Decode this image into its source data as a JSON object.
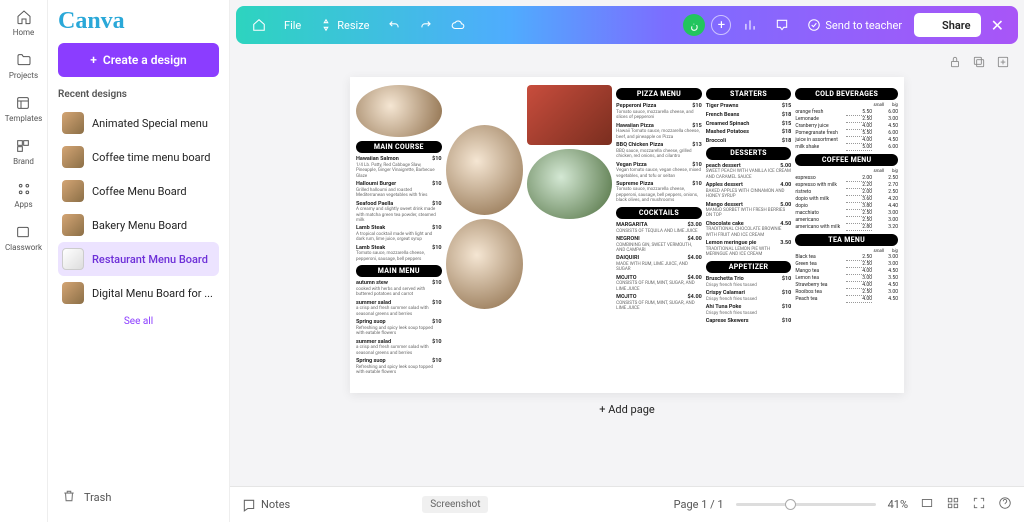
{
  "rail": {
    "items": [
      {
        "label": "Home"
      },
      {
        "label": "Projects"
      },
      {
        "label": "Templates"
      },
      {
        "label": "Brand"
      },
      {
        "label": "Apps"
      },
      {
        "label": "Classwork"
      }
    ]
  },
  "sidebar": {
    "logo": "Canva",
    "create_label": "Create a design",
    "recent_title": "Recent designs",
    "recent": [
      {
        "label": "Animated Special menu"
      },
      {
        "label": "Coffee time menu board"
      },
      {
        "label": "Coffee Menu Board"
      },
      {
        "label": "Bakery Menu Board"
      },
      {
        "label": "Restaurant Menu Board",
        "active": true
      },
      {
        "label": "Digital Menu Board for ..."
      }
    ],
    "see_all": "See all",
    "trash": "Trash"
  },
  "topbar": {
    "file": "File",
    "resize": "Resize",
    "avatar_initial": "ن",
    "send": "Send to teacher",
    "share": "Share"
  },
  "bottombar": {
    "notes": "Notes",
    "screenshot": "Screenshot",
    "page": "Page 1 / 1",
    "zoom": "41%"
  },
  "add_page": "+ Add page",
  "menu": {
    "col1": {
      "head1": "MAIN COURSE",
      "items1": [
        {
          "n": "Hawaiian Salmon",
          "p": "$10",
          "d": "1/4 Lb. Patty, Red Cabbage Slaw, Pineapple, Ginger Vinaigrette, Barbecue Glaze"
        },
        {
          "n": "Halloumi Burger",
          "p": "$10",
          "d": "Grilled halloumi and roasted Mediterranean vegetables with fries"
        },
        {
          "n": "Seafood Paella",
          "p": "$10",
          "d": "A creamy and slightly sweet drink made with matcha green tea powder, steamed milk"
        },
        {
          "n": "Lamb Steak",
          "p": "$10",
          "d": "A tropical cocktail made with light and dark rum, lime juice, orgeat syrup"
        },
        {
          "n": "Lamb Steak",
          "p": "$10",
          "d": "Tomato sauce, mozzarella cheese, pepperoni, sausage, bell peppers"
        }
      ],
      "head2": "MAIN MENU",
      "items2": [
        {
          "n": "autumn stew",
          "p": "$10",
          "d": "cooked with herbs and served with buttered potatoes and carrot"
        },
        {
          "n": "summer salad",
          "p": "$10",
          "d": "a crisp and fresh summer salad with seasonal greens and berries"
        },
        {
          "n": "Spring suop",
          "p": "$10",
          "d": "Refreshing and spicy leek soup topped with eatable flowers"
        },
        {
          "n": "summer salad",
          "p": "$10",
          "d": "a crisp and fresh summer salad with seasonal greens and berries"
        },
        {
          "n": "Spring suop",
          "p": "$10",
          "d": "Refreshing and spicy leek soup topped with eatable flowers"
        }
      ]
    },
    "col2": {
      "head1": "PIZZA MENU",
      "items1": [
        {
          "n": "Pepperoni Pizza",
          "p": "$10",
          "d": "Tomato sauce, mozzarella cheese, and slices of pepperoni"
        },
        {
          "n": "Hawaiian Pizza",
          "p": "$15",
          "d": "Hawaii Tomato sauce, mozzarella cheese, beef, and pineapple on Pizza"
        },
        {
          "n": "BBQ Chicken Pizza",
          "p": "$13",
          "d": "BBQ sauce, mozzarella cheese, grilled chicken, red onions, and cilantro"
        },
        {
          "n": "Vegan Pizza",
          "p": "$10",
          "d": "Vegan tomato sauce, vegan cheese, mixed vegetables, and tofu or seitan"
        },
        {
          "n": "Supreme Pizza",
          "p": "$10",
          "d": "Tomato sauce, mozzarella cheese, pepperoni, sausage, bell peppers, onions, black olives, and mushrooms"
        }
      ],
      "head2": "COCKTAILS",
      "items2": [
        {
          "n": "MARGARITA",
          "p": "$3.00",
          "d": "CONSISTS OF TEQUILA AND LIME JUICE"
        },
        {
          "n": "NEGRONI",
          "p": "$4.00",
          "d": "COMBINING GIN, SWEET VERMOUTH, AND CAMPARI"
        },
        {
          "n": "DAIQUIRI",
          "p": "$4.00",
          "d": "MADE WITH RUM, LIME JUICE, AND SUGAR"
        },
        {
          "n": "MOJITO",
          "p": "$4.00",
          "d": "CONSISTS OF RUM, MINT, SUGAR, AND LIME JUICE"
        },
        {
          "n": "MOJITO",
          "p": "$4.00",
          "d": "CONSISTS OF RUM, MINT, SUGAR, AND LIME JUICE"
        }
      ]
    },
    "col3": {
      "head1": "STARTERS",
      "items1": [
        {
          "n": "Tiger Prawns",
          "p": "$15"
        },
        {
          "n": "French Beans",
          "p": "$18"
        },
        {
          "n": "Creamed Spinach",
          "p": "$15"
        },
        {
          "n": "Mashed Potatoes",
          "p": "$18"
        },
        {
          "n": "Broccoli",
          "p": "$18"
        }
      ],
      "head2": "DESSERTS",
      "items2": [
        {
          "n": "peach dessert",
          "p": "5.00",
          "d": "SWEET PEACH WITH VANILLA ICE CREAM AND CARAMEL SAUCE"
        },
        {
          "n": "Apples dessert",
          "p": "4.00",
          "d": "BAKED APPLES WITH CINNAMON AND HONEY SYRUP"
        },
        {
          "n": "Mango dessert",
          "p": "5.00",
          "d": "MANGO SORBET WITH FRESH BERRIES ON TOP"
        },
        {
          "n": "Chocolate cake",
          "p": "4.50",
          "d": "TRADITIONAL CHOCOLATE BROWNIE WITH FRUIT AND ICE CREAM"
        },
        {
          "n": "Lemon meringue pie",
          "p": "3.50",
          "d": "TRADITIONAL LEMON PIE WITH MERINGUE AND ICE CREAM"
        }
      ],
      "head3": "APPETIZER",
      "items3": [
        {
          "n": "Bruschetta Trio",
          "p": "$10",
          "d": "Crispy french fries tossed"
        },
        {
          "n": "Crispy Calamari",
          "p": "$10",
          "d": "Crispy french fries tossed"
        },
        {
          "n": "Ahi Tuna Poke",
          "p": "$10",
          "d": "Crispy french fries tossed"
        },
        {
          "n": "Caprese Skewers",
          "p": "$10"
        }
      ]
    },
    "col4": {
      "head1": "COLD BEVERAGES",
      "sb_head": {
        "a": "small",
        "b": "big"
      },
      "items1": [
        {
          "n": "orange fresh",
          "a": "5.50",
          "b": "6.00"
        },
        {
          "n": "Lemonade",
          "a": "2.50",
          "b": "3.00"
        },
        {
          "n": "Cranberry juice",
          "a": "4.00",
          "b": "4.50"
        },
        {
          "n": "Pomegranate fresh",
          "a": "5.50",
          "b": "6.00"
        },
        {
          "n": "juice in assortment",
          "a": "4.00",
          "b": "4.50"
        },
        {
          "n": "milk shake",
          "a": "5.00",
          "b": "6.00"
        }
      ],
      "head2": "COFFEE MENU",
      "items2": [
        {
          "n": "espresso",
          "a": "2.00",
          "b": "2.50"
        },
        {
          "n": "espresso with milk",
          "a": "2.20",
          "b": "2.70"
        },
        {
          "n": "ristreto",
          "a": "2.00",
          "b": "2.50"
        },
        {
          "n": "dopio with milk",
          "a": "3.60",
          "b": "4.20"
        },
        {
          "n": "dopio",
          "a": "3.80",
          "b": "4.40"
        },
        {
          "n": "macchiato",
          "a": "2.50",
          "b": "3.00"
        },
        {
          "n": "americano",
          "a": "2.50",
          "b": "3.00"
        },
        {
          "n": "americano  with milk",
          "a": "2.80",
          "b": "3.20"
        }
      ],
      "head3": "TEA MENU",
      "items3": [
        {
          "n": "Black tea",
          "a": "2.50",
          "b": "3.00"
        },
        {
          "n": "Green tea",
          "a": "2.50",
          "b": "3.00"
        },
        {
          "n": "Mango tea",
          "a": "4.00",
          "b": "4.50"
        },
        {
          "n": "Lemon tea",
          "a": "3.00",
          "b": "3.50"
        },
        {
          "n": "Strawberry tea",
          "a": "4.00",
          "b": "4.50"
        },
        {
          "n": "Rooibos tea",
          "a": "2.50",
          "b": "3.00"
        },
        {
          "n": "Peach tea",
          "a": "4.00",
          "b": "4.50"
        }
      ]
    }
  }
}
